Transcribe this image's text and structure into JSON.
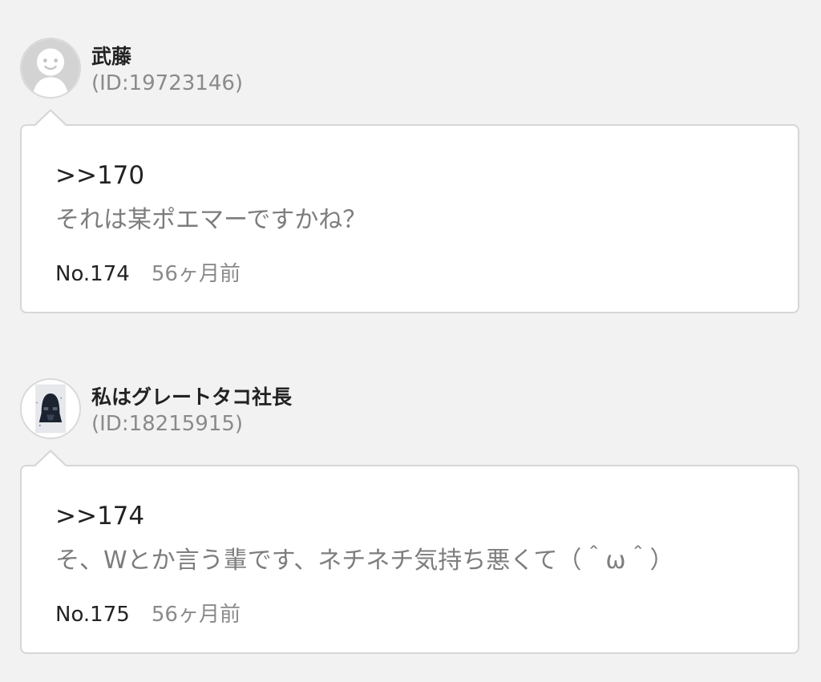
{
  "colors": {
    "background": "#f2f2f2",
    "card": "#ffffff",
    "border": "#d6d6d6",
    "text_dark": "#222222",
    "text_muted": "#8a8a8a"
  },
  "posts": [
    {
      "username": "武藤",
      "user_id": "(ID:19723146)",
      "avatar": "default-face-avatar",
      "reply_ref": ">>170",
      "message": "それは某ポエマーですかね？",
      "number": "No.174",
      "time": "56ヶ月前"
    },
    {
      "username": "私はグレートタコ社長",
      "user_id": "(ID:18215915)",
      "avatar": "dark-helmet-photo-avatar",
      "reply_ref": ">>174",
      "message": "そ、Wとか言う輩です、ネチネチ気持ち悪くて（＾ω＾）",
      "number": "No.175",
      "time": "56ヶ月前"
    }
  ]
}
